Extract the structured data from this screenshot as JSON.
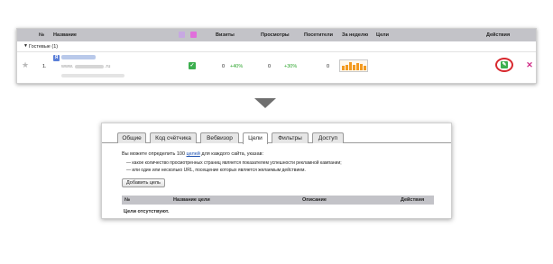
{
  "sites_table": {
    "columns": {
      "number": "№",
      "name": "Название",
      "visits": "Визиты",
      "pageviews": "Просмотры",
      "visitors": "Посетители",
      "per_week": "За неделю",
      "goals": "Цели",
      "actions": "Действия"
    },
    "group": {
      "label": "Гостевые (1)"
    },
    "row": {
      "number": "1.",
      "url_prefix": "www.",
      "url_suffix": ".ru",
      "visits_value": "0",
      "visits_change": "+40%",
      "pageviews_value": "0",
      "pageviews_change": "+30%",
      "visitors_value": "0",
      "weekly_bars": [
        0.45,
        0.6,
        0.9,
        0.55,
        0.8,
        0.65,
        0.5
      ],
      "accent_color": "#f39a1f",
      "highlight_color": "#d8282e"
    }
  },
  "goals_panel": {
    "tabs": [
      {
        "label": "Общие",
        "active": false
      },
      {
        "label": "Код счётчика",
        "active": false
      },
      {
        "label": "Вебвизор",
        "active": false
      },
      {
        "label": "Цели",
        "active": true
      },
      {
        "label": "Фильтры",
        "active": false
      },
      {
        "label": "Доступ",
        "active": false
      }
    ],
    "intro_before": "Вы можете определить 100 ",
    "intro_link": "целей",
    "intro_after": " для каждого сайта, указав:",
    "bullet1": "—  какое количество просмотренных страниц является показателем успешности рекламной кампании;",
    "bullet2": "—  или один или несколько URL, посещение которых является желаемым действием.",
    "add_button": "Добавить цель",
    "table": {
      "col_number": "№",
      "col_name": "Название цели",
      "col_description": "Описание",
      "col_actions": "Действия",
      "empty_text": "Цели отсутствуют."
    }
  }
}
